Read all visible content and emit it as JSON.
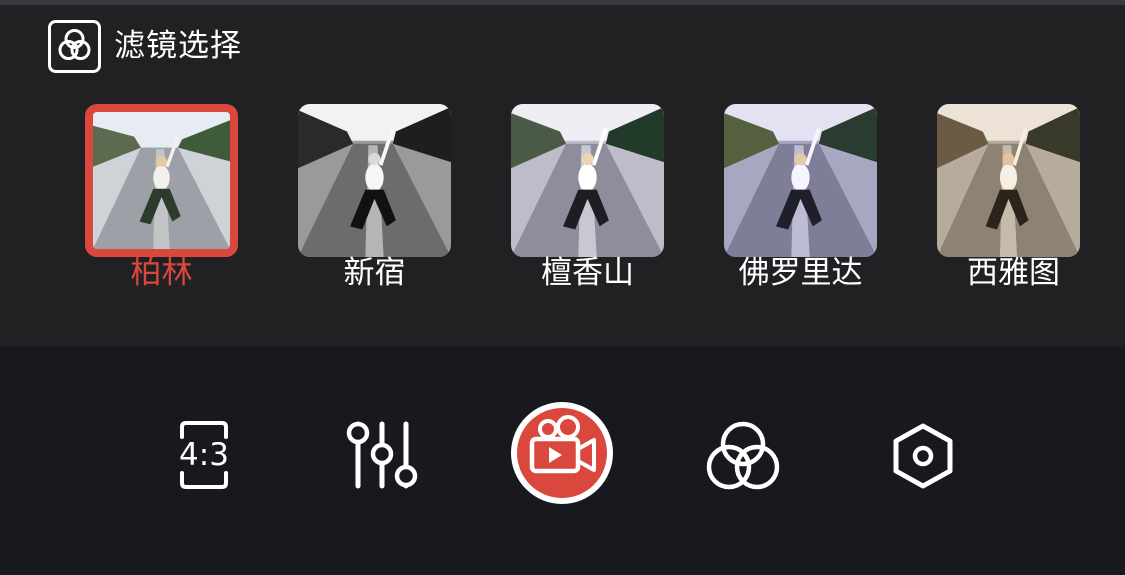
{
  "header": {
    "title": "滤镜选择",
    "icon": "filter-circles-icon"
  },
  "filters": [
    {
      "label": "柏林",
      "selected": true
    },
    {
      "label": "新宿",
      "selected": false
    },
    {
      "label": "檀香山",
      "selected": false
    },
    {
      "label": "佛罗里达",
      "selected": false
    },
    {
      "label": "西雅图",
      "selected": false
    }
  ],
  "toolbar": {
    "aspect_ratio": "4:3",
    "adjust_icon": "sliders-icon",
    "record_icon": "video-camera-icon",
    "filter_icon": "filter-circles-icon",
    "settings_icon": "hexagon-settings-icon"
  },
  "colors": {
    "accent": "#d9473d",
    "panel": "#212124",
    "toolbar_bg": "#18181f",
    "text": "#ffffff"
  }
}
